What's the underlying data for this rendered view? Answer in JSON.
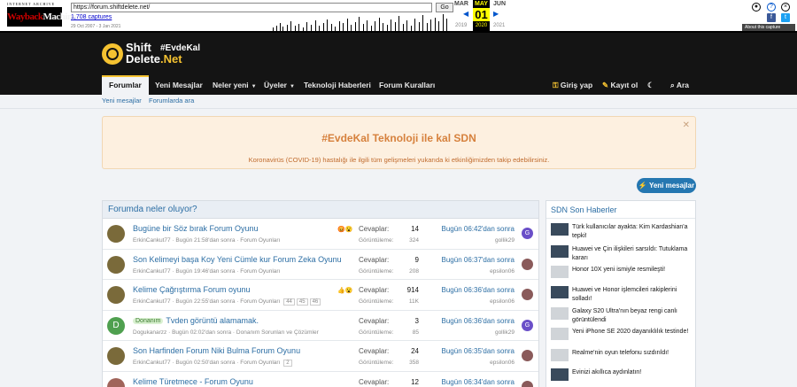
{
  "wayback": {
    "logo_top": "INTERNET ARCHIVE",
    "logo_main_a": "Wayback",
    "logo_main_b": "Machine",
    "url": "https://forum.shiftdelete.net/",
    "go": "Go",
    "captures": "1,708 captures",
    "range": "29 Oct 2007 - 3 Jan 2021",
    "prev_month": "MAR",
    "cur_month": "MAY",
    "next_month": "JUN",
    "prev_year": "2019",
    "cur_day": "01",
    "cur_year": "2020",
    "next_year": "2021",
    "about": "About this capture"
  },
  "site": {
    "logo_line1": "Shift",
    "logo_line2a": "Delete",
    "logo_line2b": ".Net",
    "tag": "#EvdeKal"
  },
  "nav": {
    "tabs": [
      "Forumlar",
      "Yeni Mesajlar",
      "Neler yeni",
      "Üyeler",
      "Teknoloji Haberleri",
      "Forum Kuralları"
    ],
    "login": "Giriş yap",
    "register": "Kayıt ol",
    "search": "Ara",
    "sub": [
      "Yeni mesajlar",
      "Forumlarda ara"
    ]
  },
  "notice": {
    "title": "#EvdeKal Teknoloji ile kal SDN",
    "text": "Koronavirüs (COVID-19) hastalığı ile ilgili tüm gelişmeleri yukarıda ki etkinliğimizden takip edebilirsiniz."
  },
  "new_posts_button": "Yeni mesajlar",
  "main": {
    "heading": "Forumda neler oluyor?",
    "label_replies": "Cevaplar:",
    "label_views": "Görüntüleme:",
    "threads": [
      {
        "title": "Bugüne bir Söz bırak Forum Oyunu",
        "prefix": "",
        "author": "ErkinCankut77",
        "started": "Bugün 21:58'dan sonra",
        "forum": "Forum Oyunları",
        "pages": [],
        "replies": "14",
        "views": "324",
        "last_time": "Bugün 06:42'dan sonra",
        "last_user": "gollik29"
      },
      {
        "title": "Son Kelimeyi başa Koy Yeni Cümle kur Forum Zeka Oyunu",
        "prefix": "",
        "author": "ErkinCankut77",
        "started": "Bugün 19:46'dan sonra",
        "forum": "Forum Oyunları",
        "pages": [],
        "replies": "9",
        "views": "208",
        "last_time": "Bugün 06:37'dan sonra",
        "last_user": "epsilon06"
      },
      {
        "title": "Kelime Çağrıştırma Forum oyunu",
        "prefix": "",
        "author": "ErkinCankut77",
        "started": "Bugün 22:55'dan sonra",
        "forum": "Forum Oyunları",
        "pages": [
          "44",
          "45",
          "46"
        ],
        "replies": "914",
        "views": "11K",
        "last_time": "Bugün 06:36'dan sonra",
        "last_user": "epsilon06"
      },
      {
        "title": "Tvden görüntü alamamak.",
        "prefix": "Donanım",
        "author": "Dogukanarzz",
        "started": "Bugün 02:02'dan sonra",
        "forum": "Donanım Sorunları ve Çözümler",
        "pages": [],
        "replies": "3",
        "views": "85",
        "last_time": "Bugün 06:36'dan sonra",
        "last_user": "gollik29"
      },
      {
        "title": "Son Harfinden Forum Niki Bulma Forum Oyunu",
        "prefix": "",
        "author": "ErkinCankut77",
        "started": "Bugün 02:50'dan sonra",
        "forum": "Forum Oyunları",
        "pages": [
          "2"
        ],
        "replies": "24",
        "views": "358",
        "last_time": "Bugün 06:35'dan sonra",
        "last_user": "epsilon06"
      },
      {
        "title": "Kelime Türetmece - Forum Oyunu",
        "prefix": "",
        "author": "",
        "started": "",
        "forum": "",
        "pages": [],
        "replies": "12",
        "views": "",
        "last_time": "Bugün 06:34'dan sonra",
        "last_user": ""
      }
    ],
    "avatar_letter": "D",
    "last_avatar_letter": "G"
  },
  "side": {
    "heading": "SDN Son Haberler",
    "items": [
      "Türk kullanıcılar ayakta: Kim Kardashian'a tepki!",
      "Huawei ve Çin ilişkileri sarsıldı: Tutuklama kararı",
      "Honor 10X yeni ismiyle resmileşti!",
      "Huawei ve Honor işlemcileri rakiplerini solladı!",
      "Galaxy S20 Ultra'nın beyaz rengi canlı görüntülendi",
      "Yeni iPhone SE 2020 dayanıklılık testinde!",
      "Realme'nin oyun telefonu sızdırıldı!",
      "Evinizi akıllıca aydınlatın!"
    ]
  },
  "colors": {
    "accent": "#f5c231",
    "link": "#2c6ea4",
    "button": "#2577b1",
    "notice_bg": "#fdf0e0"
  }
}
